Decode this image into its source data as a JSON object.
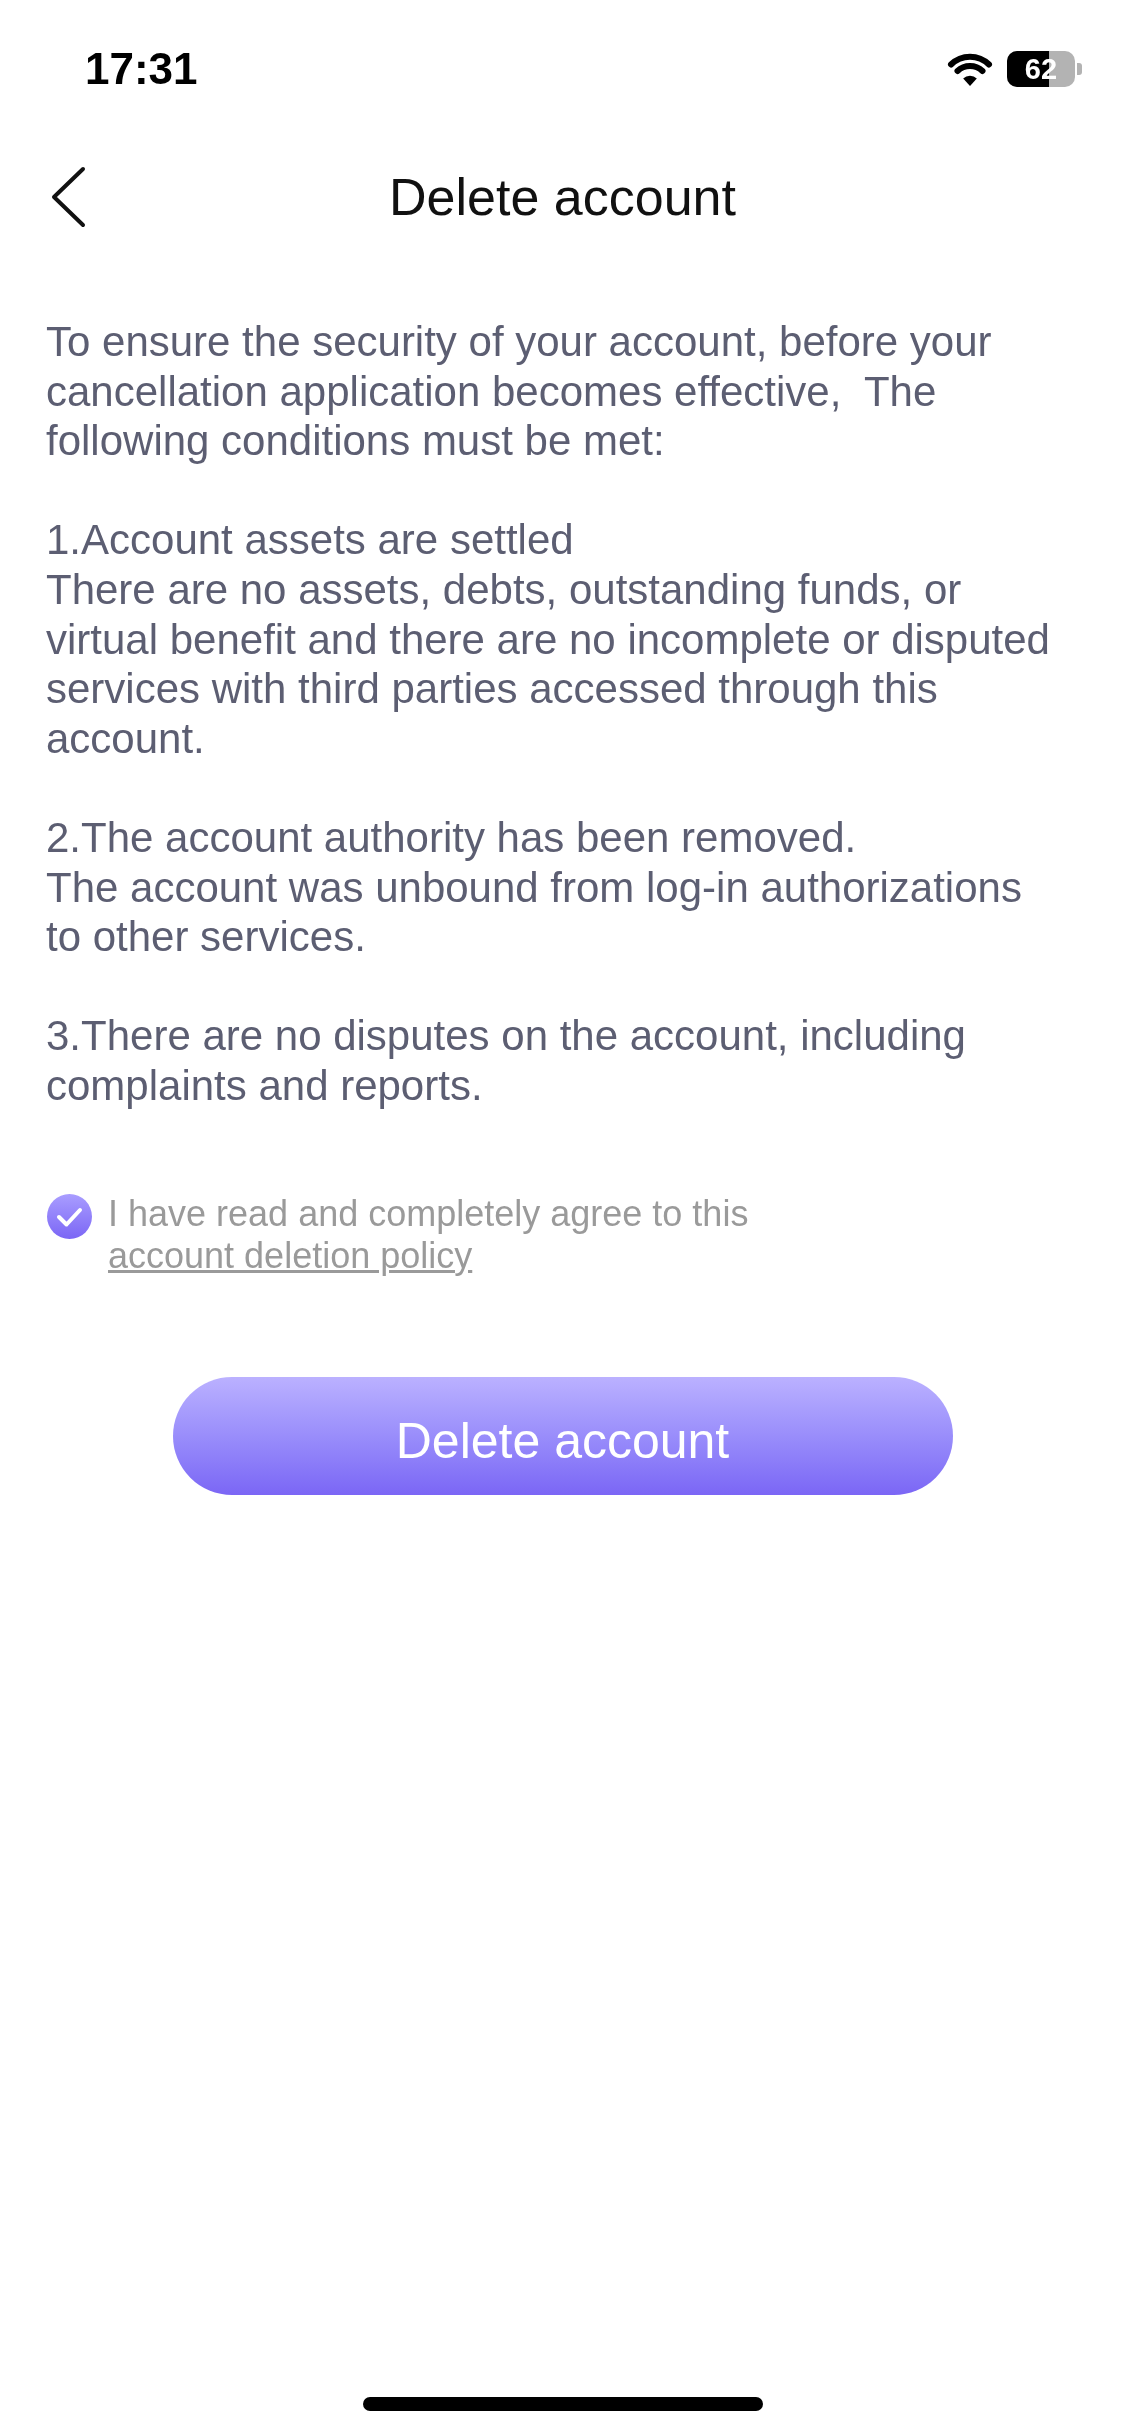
{
  "status_bar": {
    "time": "17:31",
    "battery": "62"
  },
  "header": {
    "title": "Delete account"
  },
  "intro": "To ensure the security of your account, before your cancellation application becomes effective,  The following conditions must be met:",
  "conditions": [
    {
      "title": "1.Account assets are settled",
      "description": "There are no assets, debts, outstanding funds, or virtual benefit and there are no incomplete or disputed services with third parties accessed through this account."
    },
    {
      "title": "2.The account authority has been removed.",
      "description": "The account was unbound from log-in authorizations to other services."
    },
    {
      "title": "3.There are no disputes on the account, including complaints and reports."
    }
  ],
  "agreement": {
    "checked": true,
    "text": "I have read and completely agree to this",
    "link": "account deletion policy"
  },
  "button": {
    "label": "Delete account"
  }
}
